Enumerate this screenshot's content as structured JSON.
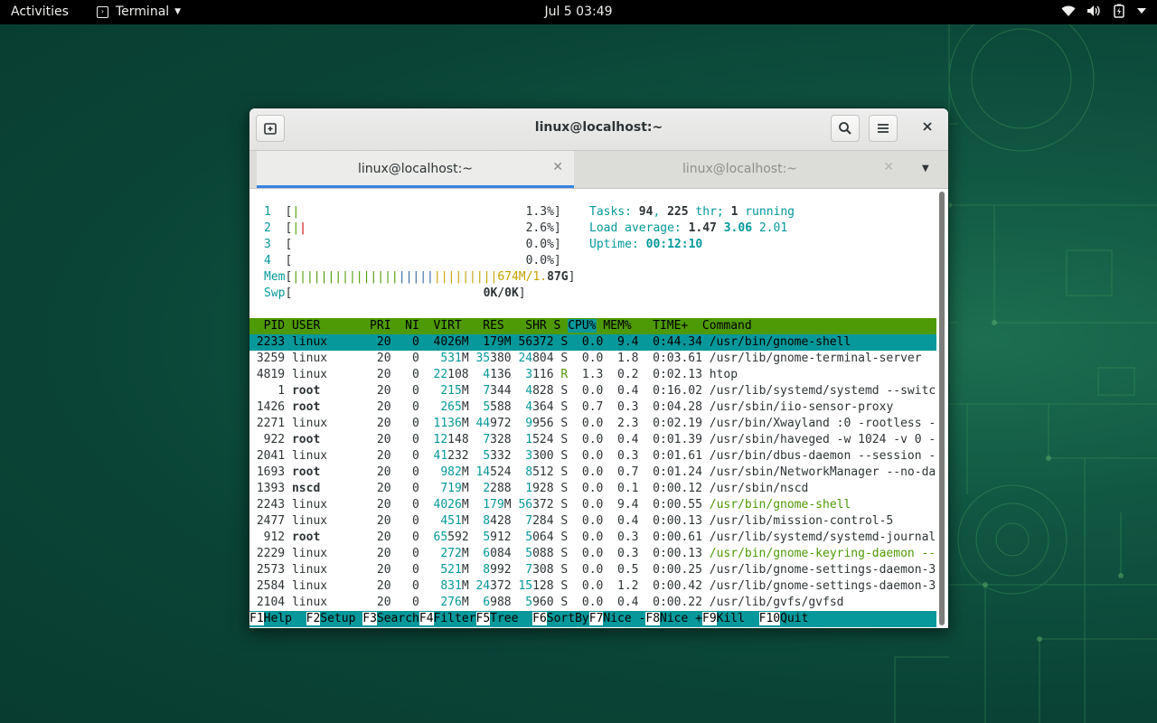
{
  "topbar": {
    "activities": "Activities",
    "app_name": "Terminal",
    "clock": "Jul 5  03:49"
  },
  "window": {
    "title": "linux@localhost:~",
    "tabs": [
      {
        "label": "linux@localhost:~",
        "active": true
      },
      {
        "label": "linux@localhost:~",
        "active": false
      }
    ]
  },
  "htop": {
    "cpus": [
      {
        "id": "1",
        "pct": "1.3%"
      },
      {
        "id": "2",
        "pct": "2.6%"
      },
      {
        "id": "3",
        "pct": "0.0%"
      },
      {
        "id": "4",
        "pct": "0.0%"
      }
    ],
    "mem_label": "Mem",
    "mem_value": "674M/1.87G",
    "swp_label": "Swp",
    "swp_value": "0K/0K",
    "tasks_label": "Tasks:",
    "tasks": "94",
    "threads": "225",
    "thr_label": "thr;",
    "running": "1",
    "running_label": "running",
    "load_label": "Load average:",
    "load1": "1.47",
    "load5": "3.06",
    "load15": "2.01",
    "uptime_label": "Uptime:",
    "uptime": "00:12:10",
    "columns": [
      "PID",
      "USER",
      "PRI",
      "NI",
      "VIRT",
      "RES",
      "SHR",
      "S",
      "CPU%",
      "MEM%",
      "TIME+",
      "Command"
    ],
    "processes": [
      {
        "pid": "2233",
        "user": "linux",
        "pri": "20",
        "ni": "0",
        "virt": "4026M",
        "res": "179M",
        "shr": "56372",
        "s": "S",
        "cpu": "0.0",
        "mem": "9.4",
        "time": "0:44.34",
        "cmd": "/usr/bin/gnome-shell",
        "selected": true
      },
      {
        "pid": "3259",
        "user": "linux",
        "pri": "20",
        "ni": "0",
        "virt": "531M",
        "res": "35380",
        "shr": "24804",
        "s": "S",
        "cpu": "0.0",
        "mem": "1.8",
        "time": "0:03.61",
        "cmd": "/usr/lib/gnome-terminal-server"
      },
      {
        "pid": "4819",
        "user": "linux",
        "pri": "20",
        "ni": "0",
        "virt": "22108",
        "res": "4136",
        "shr": "3116",
        "s": "R",
        "cpu": "1.3",
        "mem": "0.2",
        "time": "0:02.13",
        "cmd": "htop"
      },
      {
        "pid": "1",
        "user": "root",
        "pri": "20",
        "ni": "0",
        "virt": "215M",
        "res": "7344",
        "shr": "4828",
        "s": "S",
        "cpu": "0.0",
        "mem": "0.4",
        "time": "0:16.02",
        "cmd": "/usr/lib/systemd/systemd --switc"
      },
      {
        "pid": "1426",
        "user": "root",
        "pri": "20",
        "ni": "0",
        "virt": "265M",
        "res": "5588",
        "shr": "4364",
        "s": "S",
        "cpu": "0.7",
        "mem": "0.3",
        "time": "0:04.28",
        "cmd": "/usr/sbin/iio-sensor-proxy"
      },
      {
        "pid": "2271",
        "user": "linux",
        "pri": "20",
        "ni": "0",
        "virt": "1136M",
        "res": "44972",
        "shr": "9956",
        "s": "S",
        "cpu": "0.0",
        "mem": "2.3",
        "time": "0:02.19",
        "cmd": "/usr/bin/Xwayland :0 -rootless -"
      },
      {
        "pid": "922",
        "user": "root",
        "pri": "20",
        "ni": "0",
        "virt": "12148",
        "res": "7328",
        "shr": "1524",
        "s": "S",
        "cpu": "0.0",
        "mem": "0.4",
        "time": "0:01.39",
        "cmd": "/usr/sbin/haveged -w 1024 -v 0 -"
      },
      {
        "pid": "2041",
        "user": "linux",
        "pri": "20",
        "ni": "0",
        "virt": "41232",
        "res": "5332",
        "shr": "3300",
        "s": "S",
        "cpu": "0.0",
        "mem": "0.3",
        "time": "0:01.61",
        "cmd": "/usr/bin/dbus-daemon --session -"
      },
      {
        "pid": "1693",
        "user": "root",
        "pri": "20",
        "ni": "0",
        "virt": "982M",
        "res": "14524",
        "shr": "8512",
        "s": "S",
        "cpu": "0.0",
        "mem": "0.7",
        "time": "0:01.24",
        "cmd": "/usr/sbin/NetworkManager --no-da"
      },
      {
        "pid": "1393",
        "user": "nscd",
        "pri": "20",
        "ni": "0",
        "virt": "719M",
        "res": "2288",
        "shr": "1928",
        "s": "S",
        "cpu": "0.0",
        "mem": "0.1",
        "time": "0:00.12",
        "cmd": "/usr/sbin/nscd"
      },
      {
        "pid": "2243",
        "user": "linux",
        "pri": "20",
        "ni": "0",
        "virt": "4026M",
        "res": "179M",
        "shr": "56372",
        "s": "S",
        "cpu": "0.0",
        "mem": "9.4",
        "time": "0:00.55",
        "cmd": "/usr/bin/gnome-shell",
        "thread": true
      },
      {
        "pid": "2477",
        "user": "linux",
        "pri": "20",
        "ni": "0",
        "virt": "451M",
        "res": "8428",
        "shr": "7284",
        "s": "S",
        "cpu": "0.0",
        "mem": "0.4",
        "time": "0:00.13",
        "cmd": "/usr/lib/mission-control-5"
      },
      {
        "pid": "912",
        "user": "root",
        "pri": "20",
        "ni": "0",
        "virt": "65592",
        "res": "5912",
        "shr": "5064",
        "s": "S",
        "cpu": "0.0",
        "mem": "0.3",
        "time": "0:00.61",
        "cmd": "/usr/lib/systemd/systemd-journal"
      },
      {
        "pid": "2229",
        "user": "linux",
        "pri": "20",
        "ni": "0",
        "virt": "272M",
        "res": "6084",
        "shr": "5088",
        "s": "S",
        "cpu": "0.0",
        "mem": "0.3",
        "time": "0:00.13",
        "cmd": "/usr/bin/gnome-keyring-daemon --",
        "thread": true
      },
      {
        "pid": "2573",
        "user": "linux",
        "pri": "20",
        "ni": "0",
        "virt": "521M",
        "res": "8992",
        "shr": "7308",
        "s": "S",
        "cpu": "0.0",
        "mem": "0.5",
        "time": "0:00.25",
        "cmd": "/usr/lib/gnome-settings-daemon-3"
      },
      {
        "pid": "2584",
        "user": "linux",
        "pri": "20",
        "ni": "0",
        "virt": "831M",
        "res": "24372",
        "shr": "15128",
        "s": "S",
        "cpu": "0.0",
        "mem": "1.2",
        "time": "0:00.42",
        "cmd": "/usr/lib/gnome-settings-daemon-3"
      },
      {
        "pid": "2104",
        "user": "linux",
        "pri": "20",
        "ni": "0",
        "virt": "276M",
        "res": "6988",
        "shr": "5960",
        "s": "S",
        "cpu": "0.0",
        "mem": "0.4",
        "time": "0:00.22",
        "cmd": "/usr/lib/gvfs/gvfsd"
      }
    ],
    "function_keys": [
      {
        "key": "F1",
        "label": "Help  "
      },
      {
        "key": "F2",
        "label": "Setup "
      },
      {
        "key": "F3",
        "label": "Search"
      },
      {
        "key": "F4",
        "label": "Filter"
      },
      {
        "key": "F5",
        "label": "Tree  "
      },
      {
        "key": "F6",
        "label": "SortBy"
      },
      {
        "key": "F7",
        "label": "Nice -"
      },
      {
        "key": "F8",
        "label": "Nice +"
      },
      {
        "key": "F9",
        "label": "Kill  "
      },
      {
        "key": "F10",
        "label": "Quit"
      }
    ]
  },
  "colors": {
    "header_bg": "#4e9a06",
    "accent_cyan": "#06989a",
    "tab_underline": "#3584e4"
  }
}
